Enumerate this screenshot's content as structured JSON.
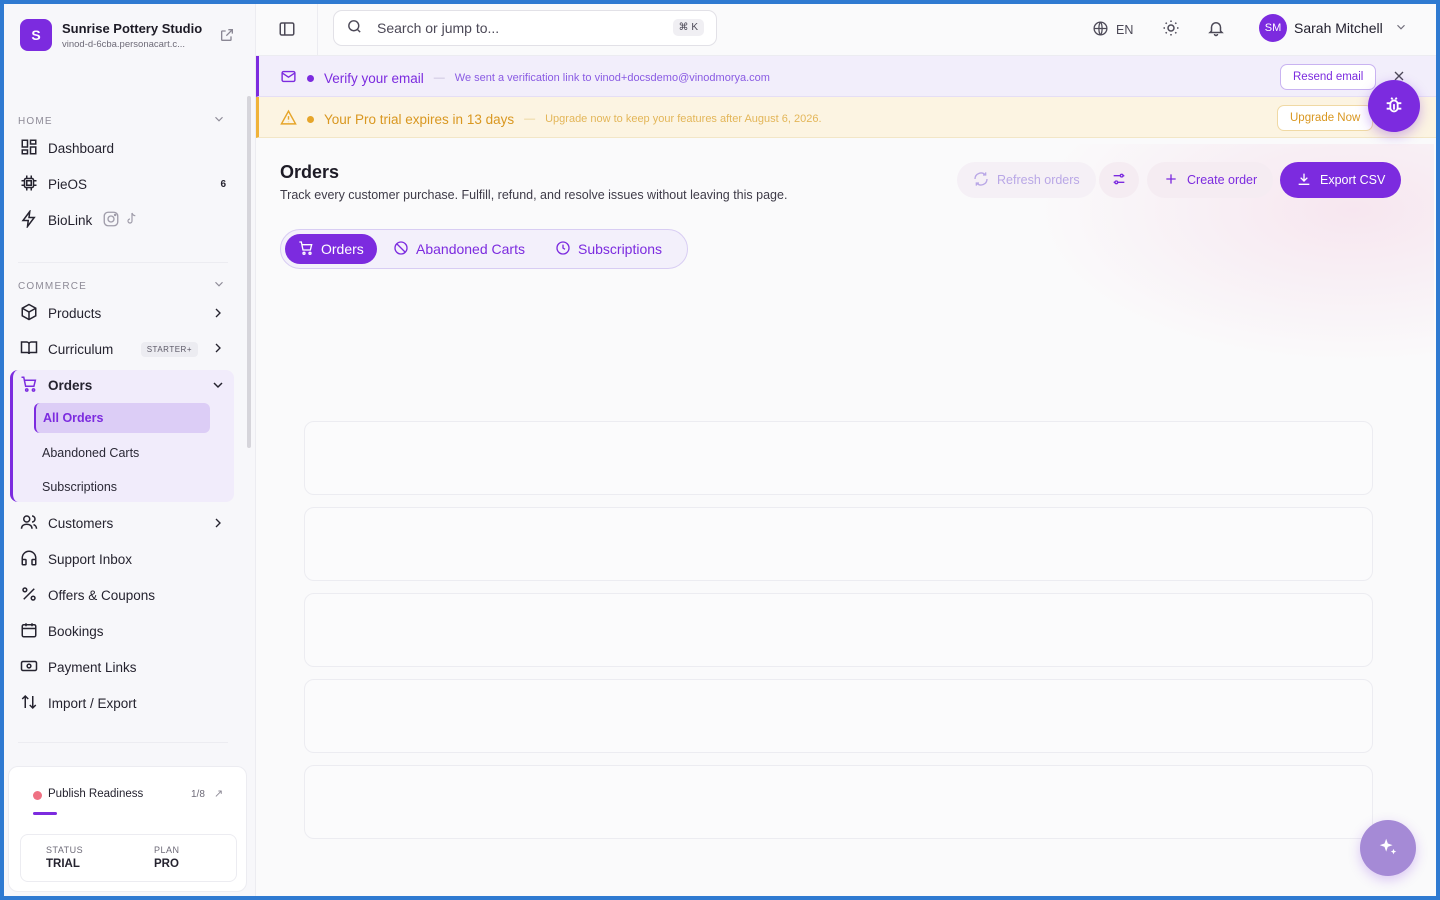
{
  "brand": {
    "initial": "S",
    "name": "Sunrise Pottery Studio",
    "domain": "vinod-d-6cba.personacart.c..."
  },
  "sidebar": {
    "home_label": "HOME",
    "commerce_label": "COMMERCE",
    "home_items": [
      {
        "label": "Dashboard",
        "icon": "dashboard-icon"
      },
      {
        "label": "PieOS",
        "icon": "chip-icon",
        "badge": "6"
      },
      {
        "label": "BioLink",
        "icon": "bolt-icon"
      }
    ],
    "commerce_items": {
      "products": "Products",
      "curriculum": "Curriculum",
      "curriculum_badge": "STARTER+",
      "orders": "Orders",
      "orders_sub": [
        "All Orders",
        "Abandoned Carts",
        "Subscriptions"
      ],
      "customers": "Customers",
      "support": "Support Inbox",
      "offers": "Offers & Coupons",
      "bookings": "Bookings",
      "payment_links": "Payment Links",
      "import_export": "Import / Export"
    },
    "readiness": {
      "label": "Publish Readiness",
      "count": "1/8",
      "progress": 0.125,
      "status_key": "STATUS",
      "status_value": "TRIAL",
      "plan_key": "PLAN",
      "plan_value": "PRO"
    }
  },
  "topbar": {
    "search_placeholder": "Search or jump to...",
    "shortcut": "⌘ K",
    "language": "EN",
    "user_initials": "SM",
    "user_name": "Sarah Mitchell"
  },
  "banners": {
    "verify": {
      "title": "Verify your email",
      "message": "We sent a verification link to vinod+docsdemo@vinodmorya.com",
      "button": "Resend email",
      "color": "#7c2bdf"
    },
    "trial": {
      "title": "Your Pro trial expires in 13 days",
      "message": "Upgrade now to keep your features after August 6, 2026.",
      "button": "Upgrade Now",
      "color": "#e6a52a"
    }
  },
  "main": {
    "title": "Orders",
    "description": "Track every customer purchase. Fulfill, refund, and resolve issues without leaving this page.",
    "actions": {
      "refresh": "Refresh orders",
      "create": "Create order",
      "export": "Export CSV"
    },
    "tabs": [
      "Orders",
      "Abandoned Carts",
      "Subscriptions"
    ],
    "active_tab": "Orders",
    "loading_rows": 5
  },
  "colors": {
    "accent": "#7c2bdf",
    "warning": "#f0b33a"
  }
}
